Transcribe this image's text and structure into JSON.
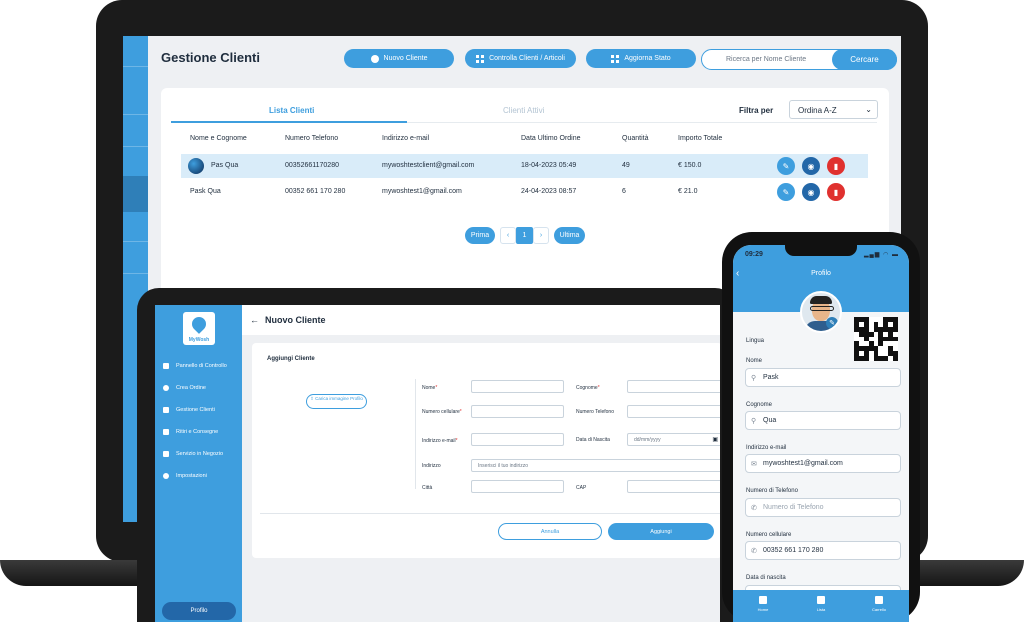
{
  "laptop": {
    "title": "Gestione Clienti",
    "buttons": {
      "new_client": "Nuovo Cliente",
      "check": "Controlla Clienti / Articoli",
      "update_status": "Aggiorna Stato"
    },
    "search": {
      "placeholder": "Ricerca per Nome Cliente",
      "button": "Cercare"
    },
    "tabs": {
      "list": "Lista Clienti",
      "active": "Clienti Attivi"
    },
    "filter": {
      "label": "Filtra per",
      "selected": "Ordina A-Z"
    },
    "columns": [
      "Nome e Cognome",
      "Numero Telefono",
      "Indirizzo e-mail",
      "Data Ultimo Ordine",
      "Quantità",
      "Importo Totale"
    ],
    "rows": [
      {
        "name": "Pas Qua",
        "phone": "00352661170280",
        "email": "mywoshtestclient@gmail.com",
        "date": "18-04-2023 05:49",
        "qty": "49",
        "total": "€ 150.0"
      },
      {
        "name": "Pask Qua",
        "phone": "00352 661 170 280",
        "email": "mywoshtest1@gmail.com",
        "date": "24-04-2023 08:57",
        "qty": "6",
        "total": "€ 21.0"
      }
    ],
    "pagination": {
      "first": "Prima",
      "prev": "‹",
      "page": "1",
      "next": "›",
      "last": "Ultima"
    },
    "icons": {
      "edit": "pencil-icon",
      "view": "eye-icon",
      "delete": "trash-icon"
    },
    "colors": {
      "accent": "#3e9ede",
      "dark": "#2367a8",
      "danger": "#e0312f",
      "highlight": "#d9ecf9"
    }
  },
  "tablet": {
    "brand": "MyWosh",
    "nav": [
      "Pannello di Controllo",
      "Crea Ordine",
      "Gestione Clienti",
      "Ritiri e Consegne",
      "Servizio in Negozio",
      "Impostazioni"
    ],
    "profile": "Profilo",
    "header": {
      "back": "←",
      "title": "Nuovo Cliente"
    },
    "form": {
      "section": "Aggiungi Cliente",
      "upload": "Carica immagine Profilo",
      "name": "Nome",
      "surname": "Cognome",
      "mobile": "Numero cellulare",
      "phone": "Numero Telefono",
      "email": "Indirizzo e-mail",
      "birth": "Data di Nascita",
      "birth_placeholder": "dd/mm/yyyy",
      "address": "Indirizzo",
      "address_placeholder": "Inserisci il tuo indirizzo",
      "city": "Città",
      "cap": "CAP",
      "cancel": "Annulla",
      "add": "Aggiungi"
    }
  },
  "phone": {
    "time": "09:29",
    "status": "▂▄▆ ◠ ▬",
    "title": "Profilo",
    "language": "Lingua",
    "fields": [
      {
        "label": "Nome",
        "value": "Pask",
        "icon": "user-icon",
        "placeholder": false
      },
      {
        "label": "Cognome",
        "value": "Qua",
        "icon": "user-icon",
        "placeholder": false
      },
      {
        "label": "Indirizzo e-mail",
        "value": "mywoshtest1@gmail.com",
        "icon": "mail-icon",
        "placeholder": false
      },
      {
        "label": "Numero di Telefono",
        "value": "Numero di Telefono",
        "icon": "phone-icon",
        "placeholder": true
      },
      {
        "label": "Numero cellulare",
        "value": "00352 661 170 280",
        "icon": "phone-icon",
        "placeholder": false
      },
      {
        "label": "Data di nascita",
        "value": "",
        "icon": "",
        "placeholder": true
      }
    ],
    "tabbar": [
      "Home",
      "Lista",
      "Carrello"
    ]
  }
}
